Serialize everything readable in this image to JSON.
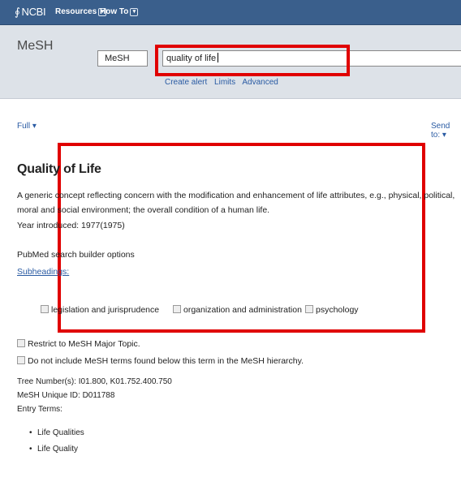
{
  "topbar": {
    "logo_text": "NCBI",
    "nav": [
      {
        "label": "Resources"
      },
      {
        "label": "How To"
      }
    ]
  },
  "search": {
    "database_title": "MeSH",
    "database_select": "MeSH",
    "query": "quality of life",
    "links": [
      "Create alert",
      "Limits",
      "Advanced"
    ]
  },
  "display": {
    "format": "Full",
    "send_to": "Send to:"
  },
  "record": {
    "title": "Quality of Life",
    "scope_note": "A generic concept reflecting concern with the modification and enhancement of life attributes, e.g., physical, political, moral and social environment; the overall condition of a human life.",
    "year_introduced": "Year introduced: 1977(1975)",
    "builder_label": "PubMed search builder options",
    "subheadings_label": "Subheadings:",
    "subheadings": [
      "legislation and jurisprudence",
      "organization and administration",
      "psychology"
    ],
    "options": [
      "Restrict to MeSH Major Topic.",
      "Do not include MeSH terms found below this term in the MeSH hierarchy."
    ],
    "tree_numbers": "Tree Number(s): I01.800, K01.752.400.750",
    "unique_id": "MeSH Unique ID: D011788",
    "entry_terms_label": "Entry Terms:",
    "entry_terms": [
      "Life Qualities",
      "Life Quality"
    ]
  },
  "annotations": {
    "highlight_color": "#e00000"
  }
}
